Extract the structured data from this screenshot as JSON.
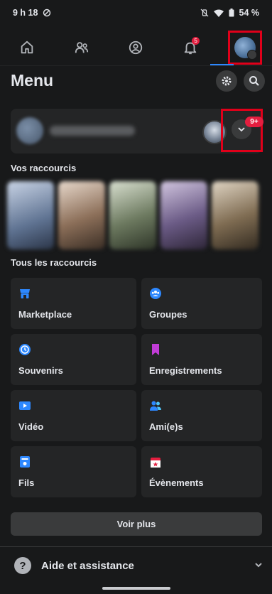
{
  "status": {
    "time": "9 h 18",
    "battery": "54 %"
  },
  "nav": {
    "items": [
      "home-icon",
      "friends-icon",
      "profile-circle-icon",
      "bell-icon",
      "profile-avatar"
    ],
    "notif_count": "5"
  },
  "menu": {
    "title": "Menu"
  },
  "profile_card": {
    "badge": "9+"
  },
  "sections": {
    "your_shortcuts": "Vos raccourcis",
    "all_shortcuts": "Tous les raccourcis"
  },
  "tiles": [
    {
      "label": "Marketplace",
      "icon": "shop-icon",
      "color": "#2d88ff"
    },
    {
      "label": "Groupes",
      "icon": "groups-icon",
      "color": "#2d88ff"
    },
    {
      "label": "Souvenirs",
      "icon": "clock-icon",
      "color": "#2d88ff"
    },
    {
      "label": "Enregistrements",
      "icon": "bookmark-icon",
      "color": "#c13cd6"
    },
    {
      "label": "Vidéo",
      "icon": "video-icon",
      "color": "#2d88ff"
    },
    {
      "label": "Ami(e)s",
      "icon": "friends-icon",
      "color": "#2d88ff"
    },
    {
      "label": "Fils",
      "icon": "feeds-icon",
      "color": "#2d88ff"
    },
    {
      "label": "Évènements",
      "icon": "calendar-icon",
      "color": "#e41e3f"
    }
  ],
  "see_more": "Voir plus",
  "help": {
    "label": "Aide et assistance"
  },
  "colors": {
    "accent": "#2d88ff",
    "highlight": "#e0001a",
    "badge": "#e41e3f"
  }
}
